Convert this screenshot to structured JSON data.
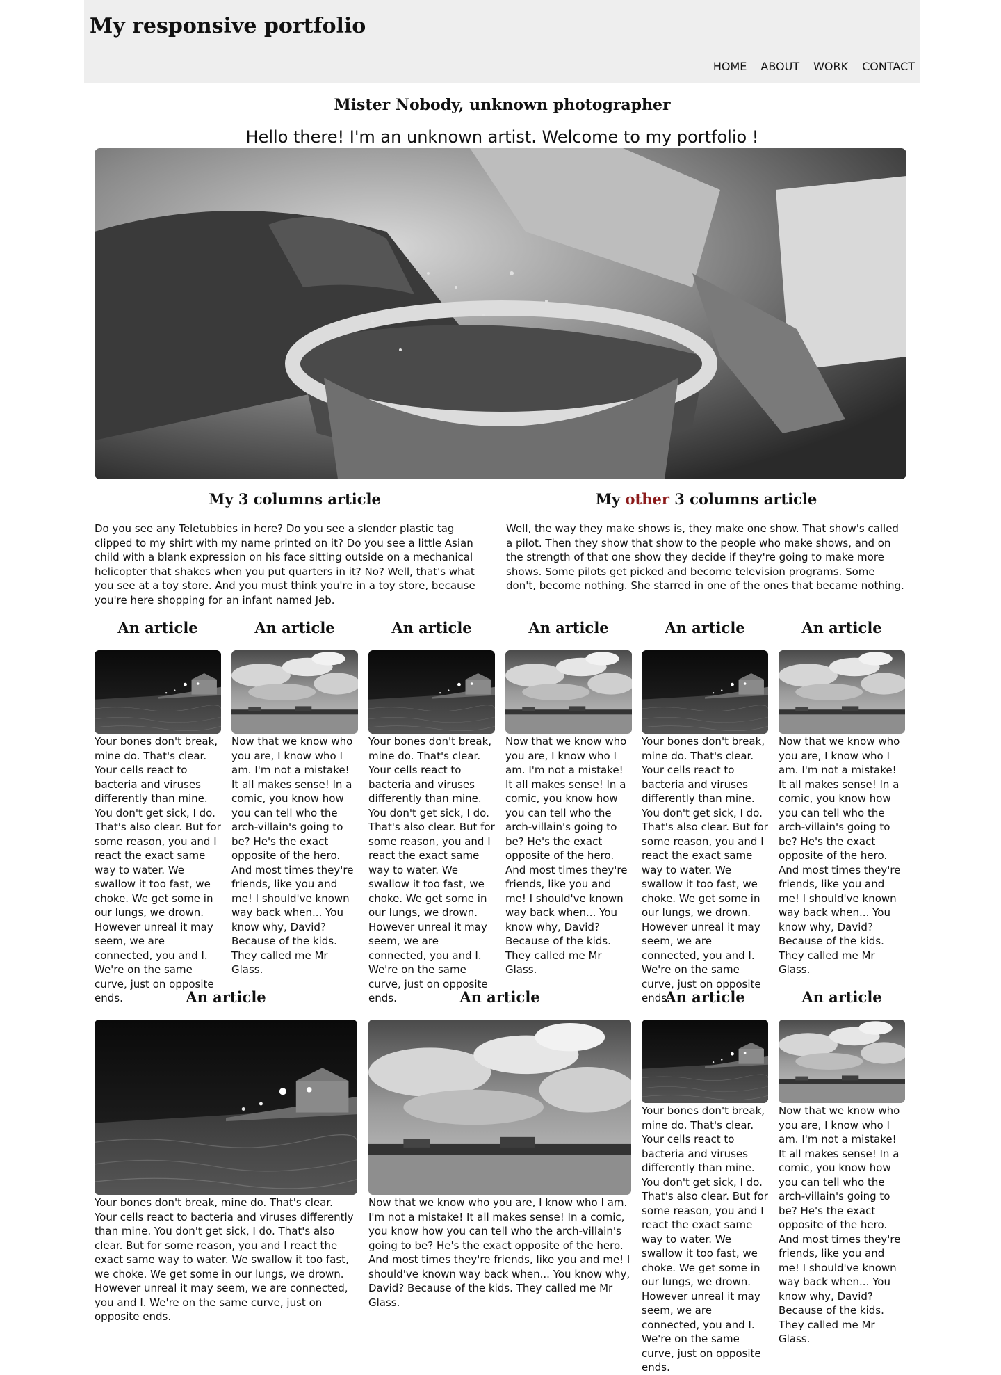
{
  "header": {
    "title": "My responsive portfolio",
    "nav": [
      "HOME",
      "ABOUT",
      "WORK",
      "CONTACT"
    ]
  },
  "intro": {
    "heading": "Mister Nobody, unknown photographer",
    "welcome": "Hello there! I'm an unknown artist. Welcome to my portfolio !"
  },
  "two_col": {
    "left": {
      "title": "My 3 columns article",
      "text": "Do you see any Teletubbies in here? Do you see a slender plastic tag clipped to my shirt with my name printed on it? Do you see a little Asian child with a blank expression on his face sitting outside on a mechanical helicopter that shakes when you put quarters in it? No? Well, that's what you see at a toy store. And you must think you're in a toy store, because you're here shopping for an infant named Jeb."
    },
    "right": {
      "title_prefix": "My ",
      "title_accent": "other",
      "title_suffix": " 3 columns article",
      "text": "Well, the way they make shows is, they make one show. That show's called a pilot. Then they show that show to the people who make shows, and on the strength of that one show they decide if they're going to make more shows. Some pilots get picked and become television programs. Some don't, become nothing. She starred in one of the ones that became nothing."
    }
  },
  "article_title": "An article",
  "texts": {
    "bones": "Your bones don't break, mine do. That's clear. Your cells react to bacteria and viruses differently than mine. You don't get sick, I do. That's also clear. But for some reason, you and I react the exact same way to water. We swallow it too fast, we choke. We get some in our lungs, we drown. However unreal it may seem, we are connected, you and I. We're on the same curve, just on opposite ends.",
    "glass": "Now that we know who you are, I know who I am. I'm not a mistake! It all makes sense! In a comic, you know how you can tell who the arch-villain's going to be? He's the exact opposite of the hero. And most times they're friends, like you and me! I should've known way back when... You know why, David? Because of the kids. They called me Mr Glass."
  }
}
